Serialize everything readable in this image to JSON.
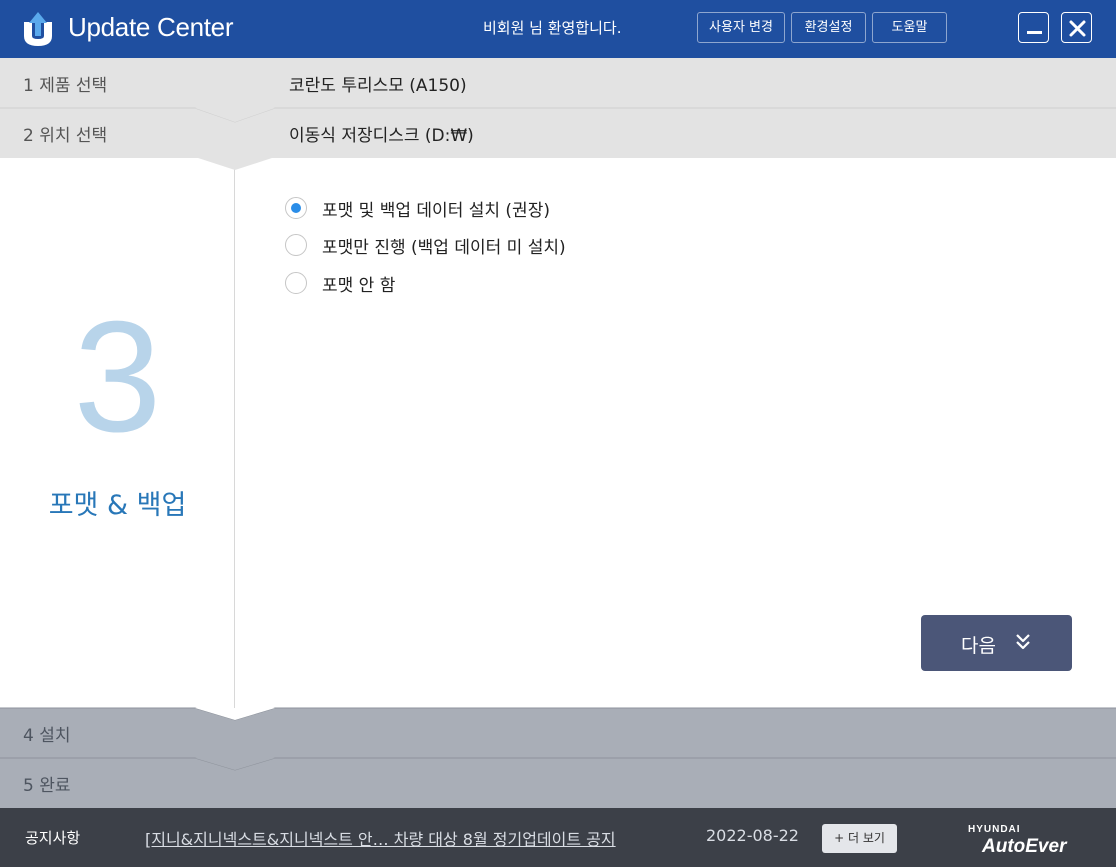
{
  "app": {
    "title": "Update Center",
    "welcome": "비회원 님 환영합니다."
  },
  "header": {
    "buttons": [
      {
        "label": "사용자 변경"
      },
      {
        "label": "환경설정"
      },
      {
        "label": "도움말"
      }
    ]
  },
  "steps": [
    {
      "label": "1  제품 선택",
      "value": "코란도 투리스모 (A150)"
    },
    {
      "label": "2  위치 선택",
      "value": "이동식 저장디스크 (D:₩)"
    },
    {
      "number": "3",
      "name": "포맷 & 백업"
    },
    {
      "label": "4  설치"
    },
    {
      "label": "5  완료"
    }
  ],
  "options": [
    {
      "label": "포맷 및 백업 데이터 설치 (권장)",
      "checked": true
    },
    {
      "label": "포맷만 진행 (백업 데이터 미 설치)",
      "checked": false
    },
    {
      "label": "포맷 안 함",
      "checked": false
    }
  ],
  "next_button": {
    "label": "다음",
    "icon": "double-chevron-down-icon"
  },
  "footer": {
    "notice_title": "공지사항",
    "notice_text": "[지니&지니넥스트&지니넥스트  안… 차량 대상 8월 정기업데이트 공지",
    "notice_date": "2022-08-22",
    "more_label": "+ 더 보기",
    "brand_top": "HYUNDAI",
    "brand_main": "AutoEver"
  },
  "colors": {
    "titlebar": "#1f4fa0",
    "accent": "#2877b8",
    "radio_checked": "#2a8de8",
    "next_button": "#4b5678",
    "footer": "#3c4048"
  }
}
